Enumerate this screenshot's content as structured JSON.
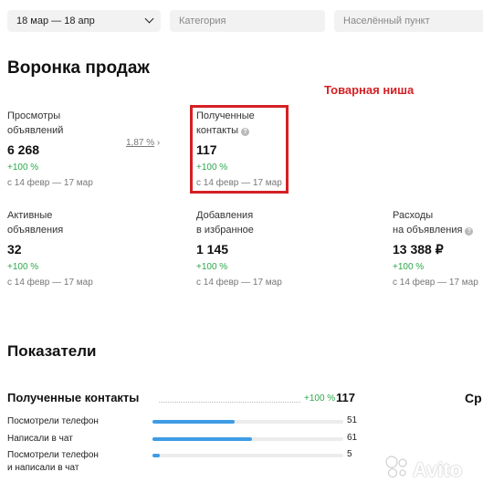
{
  "filters": {
    "date": "18 мар — 18 апр",
    "category_placeholder": "Категория",
    "city_placeholder": "Населённый пункт"
  },
  "funnel": {
    "title": "Воронка продаж",
    "niche_label": "Товарная ниша",
    "conversion": "1,87 %",
    "metrics": {
      "views": {
        "label1": "Просмотры",
        "label2": "объявлений",
        "value": "6 268",
        "change": "+100 %",
        "period": "с 14 февр — 17 мар"
      },
      "contacts": {
        "label1": "Полученные",
        "label2": "контакты",
        "value": "117",
        "change": "+100 %",
        "period": "с 14 февр — 17 мар"
      },
      "active": {
        "label1": "Активные",
        "label2": "объявления",
        "value": "32",
        "change": "+100 %",
        "period": "с 14 февр — 17 мар"
      },
      "favorites": {
        "label1": "Добавления",
        "label2": "в избранное",
        "value": "1 145",
        "change": "+100 %",
        "period": "с 14 февр — 17 мар"
      },
      "expenses": {
        "label1": "Расходы",
        "label2": "на объявления",
        "value": "13 388 ₽",
        "change": "+100 %",
        "period": "с 14 февр — 17 мар"
      }
    }
  },
  "indicators": {
    "title": "Показатели",
    "section_title": "Полученные контакты",
    "section_change": "+100 %",
    "section_value": "117",
    "right_cut_text": "Ср",
    "rows": [
      {
        "label1": "Посмотрели телефон",
        "label2": "",
        "value": "51",
        "fraction": 0.43
      },
      {
        "label1": "Написали в чат",
        "label2": "",
        "value": "61",
        "fraction": 0.52
      },
      {
        "label1": "Посмотрели телефон",
        "label2": "и написали в чат",
        "value": "5",
        "fraction": 0.04
      }
    ]
  },
  "watermark": {
    "text": "Avito",
    "icon": "avito-logo-icon"
  }
}
